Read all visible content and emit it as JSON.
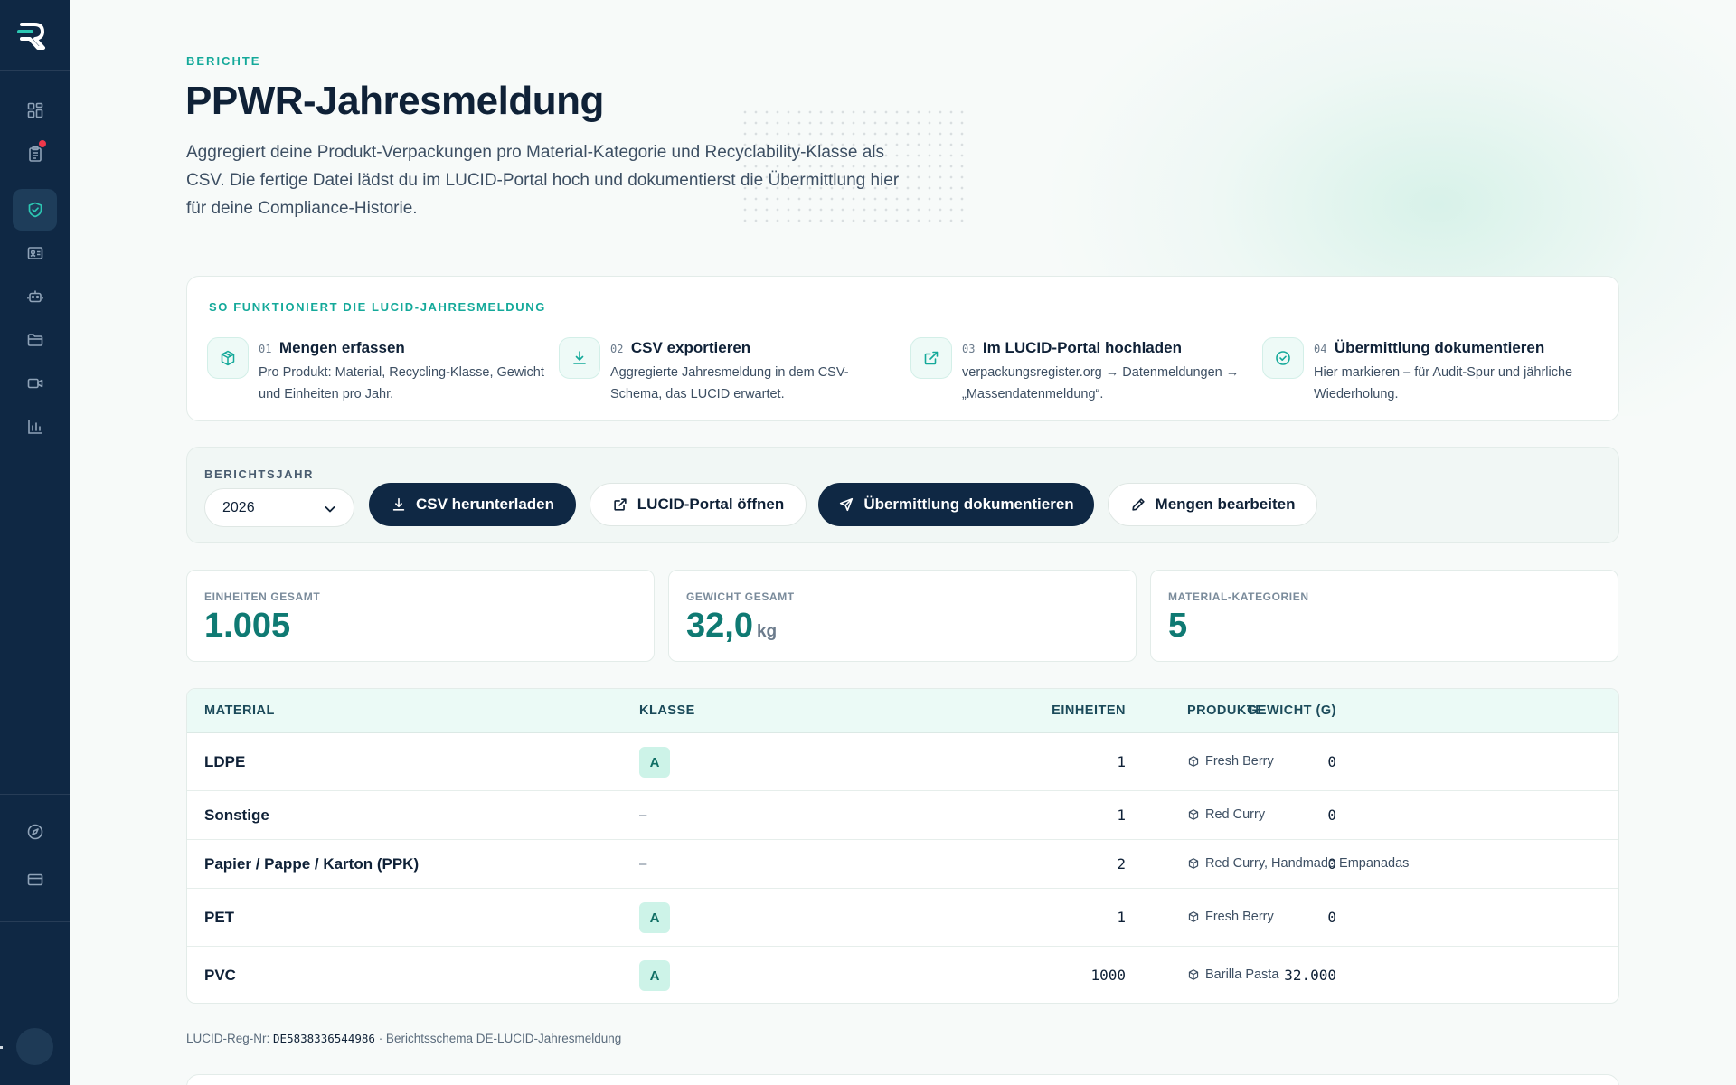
{
  "page": {
    "eyebrow": "BERICHTE",
    "title": "PPWR-Jahresmeldung",
    "description": "Aggregiert deine Produkt-Verpackungen pro Material-Kategorie und Recyclability-Klasse als CSV. Die fertige Datei lädst du im LUCID-Portal hoch und dokumentierst die Übermittlung hier für deine Compliance-Historie."
  },
  "sidebar": {
    "items": [
      {
        "icon": "dashboard-icon",
        "active": false
      },
      {
        "icon": "clipboard-icon",
        "active": false,
        "notification": true
      },
      {
        "icon": "shield-check-icon",
        "active": true
      },
      {
        "icon": "id-card-icon",
        "active": false
      },
      {
        "icon": "robot-icon",
        "active": false
      },
      {
        "icon": "folder-icon",
        "active": false
      },
      {
        "icon": "video-icon",
        "active": false
      },
      {
        "icon": "bar-chart-icon",
        "active": false
      }
    ],
    "bottom_items": [
      {
        "icon": "compass-icon"
      },
      {
        "icon": "credit-card-icon"
      }
    ]
  },
  "how": {
    "title": "SO FUNKTIONIERT DIE LUCID-JAHRESMELDUNG",
    "steps": [
      {
        "num": "01",
        "title": "Mengen erfassen",
        "text": "Pro Produkt: Material, Recycling-Klasse, Gewicht und Einheiten pro Jahr.",
        "icon": "package-icon"
      },
      {
        "num": "02",
        "title": "CSV exportieren",
        "text": "Aggregierte Jahresmeldung in dem CSV-Schema, das LUCID erwartet.",
        "icon": "download-icon"
      },
      {
        "num": "03",
        "title": "Im LUCID-Portal hochladen",
        "text": "verpackungsregister.org → Datenmeldungen → „Massendatenmeldung“.",
        "icon": "external-link-icon"
      },
      {
        "num": "04",
        "title": "Übermittlung dokumentieren",
        "text": "Hier markieren – für Audit-Spur und jährliche Wiederholung.",
        "icon": "check-circle-icon"
      }
    ]
  },
  "controls": {
    "year_label": "BERICHTSJAHR",
    "year_value": "2026",
    "buttons": {
      "csv": "CSV herunterladen",
      "portal": "LUCID-Portal öffnen",
      "document": "Übermittlung dokumentieren",
      "edit": "Mengen bearbeiten"
    }
  },
  "stats": [
    {
      "label": "EINHEITEN GESAMT",
      "value": "1.005",
      "unit": ""
    },
    {
      "label": "GEWICHT GESAMT",
      "value": "32,0",
      "unit": "kg"
    },
    {
      "label": "MATERIAL-KATEGORIEN",
      "value": "5",
      "unit": ""
    }
  ],
  "table": {
    "headers": {
      "material": "MATERIAL",
      "klasse": "KLASSE",
      "einheiten": "EINHEITEN",
      "gewicht": "GEWICHT (G)",
      "produkte": "PRODUKTE"
    },
    "rows": [
      {
        "material": "LDPE",
        "klasse": "A",
        "einheiten": "1",
        "gewicht": "0",
        "produkte": "Fresh Berry"
      },
      {
        "material": "Sonstige",
        "klasse": "–",
        "einheiten": "1",
        "gewicht": "0",
        "produkte": "Red Curry"
      },
      {
        "material": "Papier / Pappe / Karton (PPK)",
        "klasse": "–",
        "einheiten": "2",
        "gewicht": "0",
        "produkte": "Red Curry, Handmade Empanadas"
      },
      {
        "material": "PET",
        "klasse": "A",
        "einheiten": "1",
        "gewicht": "0",
        "produkte": "Fresh Berry"
      },
      {
        "material": "PVC",
        "klasse": "A",
        "einheiten": "1000",
        "gewicht": "32.000",
        "produkte": "Barilla Pasta"
      }
    ]
  },
  "footer": {
    "reg_label": "LUCID-Reg-Nr:",
    "reg_number": "DE5838336544986",
    "schema": "· Berichtsschema DE-LUCID-Jahresmeldung"
  },
  "colors": {
    "sidebar": "#0f2844",
    "accent": "#14a99a",
    "stat_value": "#0f7a73",
    "badge_bg": "#cdf3e8",
    "notification": "#f0384b"
  }
}
